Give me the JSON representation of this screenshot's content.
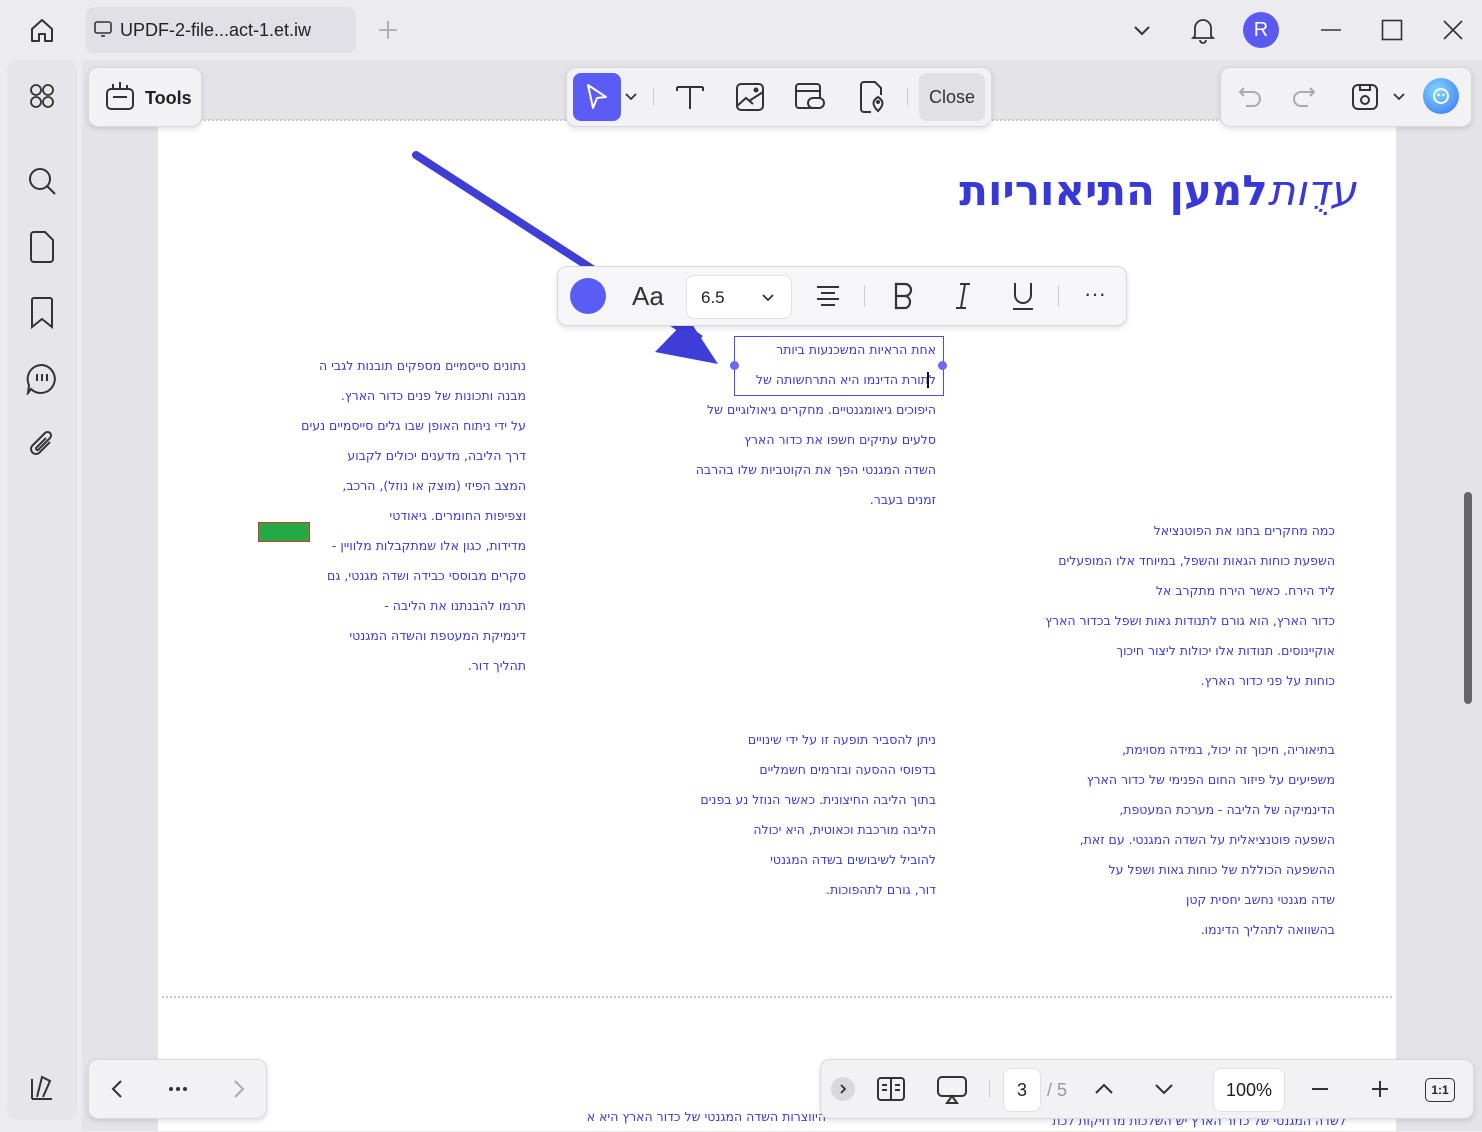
{
  "tab": {
    "title": "UPDF-2-file...act-1.et.iw"
  },
  "user": {
    "avatar_letter": "R"
  },
  "tools": {
    "label": "Tools"
  },
  "edit_toolbar": {
    "close_label": "Close"
  },
  "format_toolbar": {
    "font_size": "6.5",
    "font_label": "Aa",
    "more": "···"
  },
  "colors": {
    "accent": "#5b5bf5",
    "text_blue": "#3b3bd4",
    "arrow": "#3e3ed6",
    "highlight_green": "#22aa44"
  },
  "document": {
    "title_italic": "עדֻות",
    "title_bold": "למען התיאוריות",
    "selected_block": [
      "אחת הראיות המשכנעות ביותר",
      "לתורת הדינמו היא התרחשותה של"
    ],
    "center_upper": [
      "היפוכים גיאומגנטיים. מחקרים גיאולוגיים של",
      "סלעים עתיקים חשפו את כדור הארץ",
      "השדה המגנטי הפך את הקוטביות שלו בהרבה",
      "זמנים בעבר."
    ],
    "left_column": [
      "נתונים סייסמיים מספקים תובנות לגבי ה",
      "מבנה ותכונות של פנים כדור הארץ.",
      "על ידי ניתוח האופן שבו גלים סייסמיים נעים",
      "דרך הליבה, מדענים יכולים לקבוע",
      "המצב הפיזי (מוצק או נוזל), הרכב,",
      "וצפיפות החומרים. גיאודטי",
      "מדידות, כגון אלו שמתקבלות מלוויין -",
      "סקרים מבוססי כבידה ושדה מגנטי, גם",
      "תרמו להבנתנו את הליבה -",
      "דינמיקת המעטפת והשדה המגנטי",
      "תהליך דור."
    ],
    "right_upper": [
      "כמה מחקרים בחנו את הפוטנציאל",
      "השפעת כוחות הגאות והשפל, במיוחד אלו המופעלים",
      "ליד הירח. כאשר הירח מתקרב אל",
      "כדור הארץ, הוא גורם לתנודות גאות ושפל בכדור הארץ",
      "אוקיינוסים. תנודות אלו יכולות ליצור חיכוך",
      "כוחות על פני כדור הארץ."
    ],
    "center_lower": [
      "ניתן להסביר תופעה זו על ידי שינויים",
      "בדפוסי ההסעה ובזרמים חשמליים",
      "בתוך הליבה החיצונית. כאשר הנוזל נע בפנים",
      "הליבה מורכבת וכאוטית, היא יכולה",
      "להוביל לשיבושים בשדה המגנטי",
      "דור, גורם לתהפוכות."
    ],
    "right_lower": [
      "בתיאוריה, חיכוך זה יכול, במידה מסוימת,",
      "משפיעים על פיזור החום הפנימי של כדור הארץ",
      "הדינמיקה של הליבה - מערכת המעטפת,",
      "השפעה פוטנציאלית על השדה המגנטי. עם זאת,",
      "ההשפעה הכוללת של כוחות גאות ושפל על",
      "שדה מגנטי נחשב יחסית קטן",
      "בהשוואה לתהליך הדינמו."
    ],
    "bottom_peek_left": "היווצרות השדה המגנטי של כדור הארץ היא א",
    "bottom_peek_right": "לשדה המגנטי של כדור הארץ יש השלכות מרחיקות לכת"
  },
  "pagination": {
    "current_page": "3",
    "total_pages": "/ 5",
    "zoom": "100%",
    "fit_label": "1:1"
  }
}
